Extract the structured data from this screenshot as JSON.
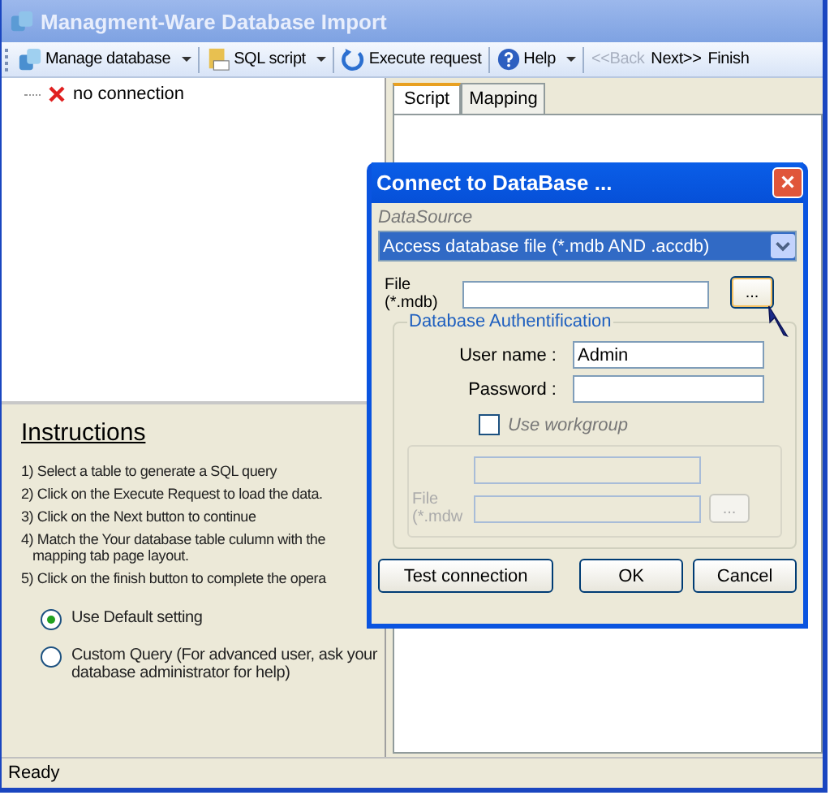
{
  "window": {
    "title": "Managment-Ware Database Import"
  },
  "toolbar": [
    {
      "label": "Manage database",
      "kind": "dropdown",
      "disabled": false
    },
    {
      "label": "SQL script",
      "kind": "dropdown",
      "disabled": false
    },
    {
      "label": "Execute request",
      "kind": "button",
      "disabled": false
    },
    {
      "label": "Help",
      "kind": "dropdown",
      "disabled": false
    },
    {
      "label": "<<Back",
      "kind": "nav",
      "disabled": true
    },
    {
      "label": "Next>>",
      "kind": "nav",
      "disabled": false
    },
    {
      "label": "Finish",
      "kind": "nav",
      "disabled": false
    }
  ],
  "tree": [
    {
      "label": "no connection"
    }
  ],
  "tabs": [
    {
      "label": "Script",
      "selected": true
    },
    {
      "label": "Mapping",
      "selected": false
    }
  ],
  "instructions": {
    "heading": "Instructions",
    "steps": [
      "1) Select a table to generate a SQL query",
      "2) Click on the Execute Request to load the data.",
      "3) Click on the Next button to continue",
      "4) Match the Your database table culumn with the mapping tab page layout.",
      "5) Click on the finish button to complete the opera"
    ],
    "options": [
      {
        "label": "Use Default setting",
        "selected": true
      },
      {
        "label": "Custom Query (For advanced user, ask your database administrator for help)",
        "selected": false
      }
    ]
  },
  "status_bar": "Ready",
  "dialog": {
    "title": "Connect to DataBase ...",
    "close": "×",
    "datasource_label": "DataSource",
    "datasource": "Access database file (*.mdb AND .accdb)",
    "file_label": "File (*.mdb)",
    "browse": "...",
    "auth_legend": "Database Authentification",
    "user_label": "User name :",
    "user": "Admin",
    "password_label": "Password :",
    "workgroup": {
      "label": "Use workgroup",
      "checked": false
    },
    "workgroup_file_label": "File (*.mdw",
    "workgroup_browse": "...",
    "buttons": [
      "Test connection",
      "OK",
      "Cancel"
    ]
  }
}
